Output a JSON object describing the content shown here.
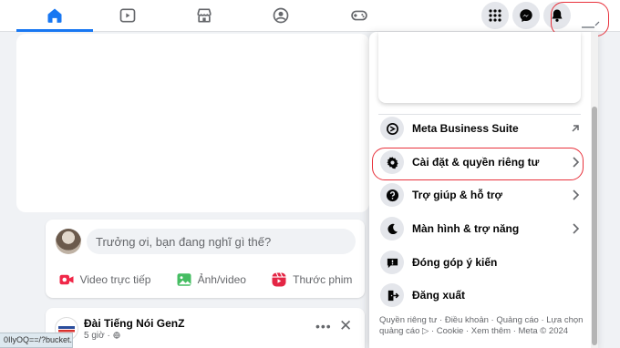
{
  "composer": {
    "placeholder": "Trưởng ơi, bạn đang nghĩ gì thế?",
    "actions": [
      {
        "label": "Video trực tiếp",
        "color": "#f02849"
      },
      {
        "label": "Ảnh/video",
        "color": "#45bd62"
      },
      {
        "label": "Thước phim",
        "color": "#e42645"
      }
    ]
  },
  "post": {
    "author": "Đài Tiếng Nói GenZ",
    "time": "5 giờ ·",
    "more": "•••",
    "close": "✕"
  },
  "status_url": "0IlyOQ==/?bucket...",
  "menu": {
    "items": [
      {
        "label": "Meta Business Suite",
        "icon": "meta-business-icon",
        "trail": "external-link-icon"
      },
      {
        "label": "Cài đặt & quyền riêng tư",
        "icon": "gear-icon",
        "trail": "chevron-right-icon"
      },
      {
        "label": "Trợ giúp & hỗ trợ",
        "icon": "question-icon",
        "trail": "chevron-right-icon"
      },
      {
        "label": "Màn hình & trợ năng",
        "icon": "moon-icon",
        "trail": "chevron-right-icon"
      },
      {
        "label": "Đóng góp ý kiến",
        "icon": "feedback-icon",
        "trail": ""
      },
      {
        "label": "Đăng xuất",
        "icon": "logout-icon",
        "trail": ""
      }
    ],
    "footer": {
      "line1": "Quyền riêng tư · Điều khoản · Quảng cáo · Lựa chọn",
      "line2": "quảng cáo ▷ · Cookie · Xem thêm · Meta © 2024"
    }
  },
  "colors": {
    "accent": "#1877f2",
    "highlight_ring": "#e8323c"
  }
}
